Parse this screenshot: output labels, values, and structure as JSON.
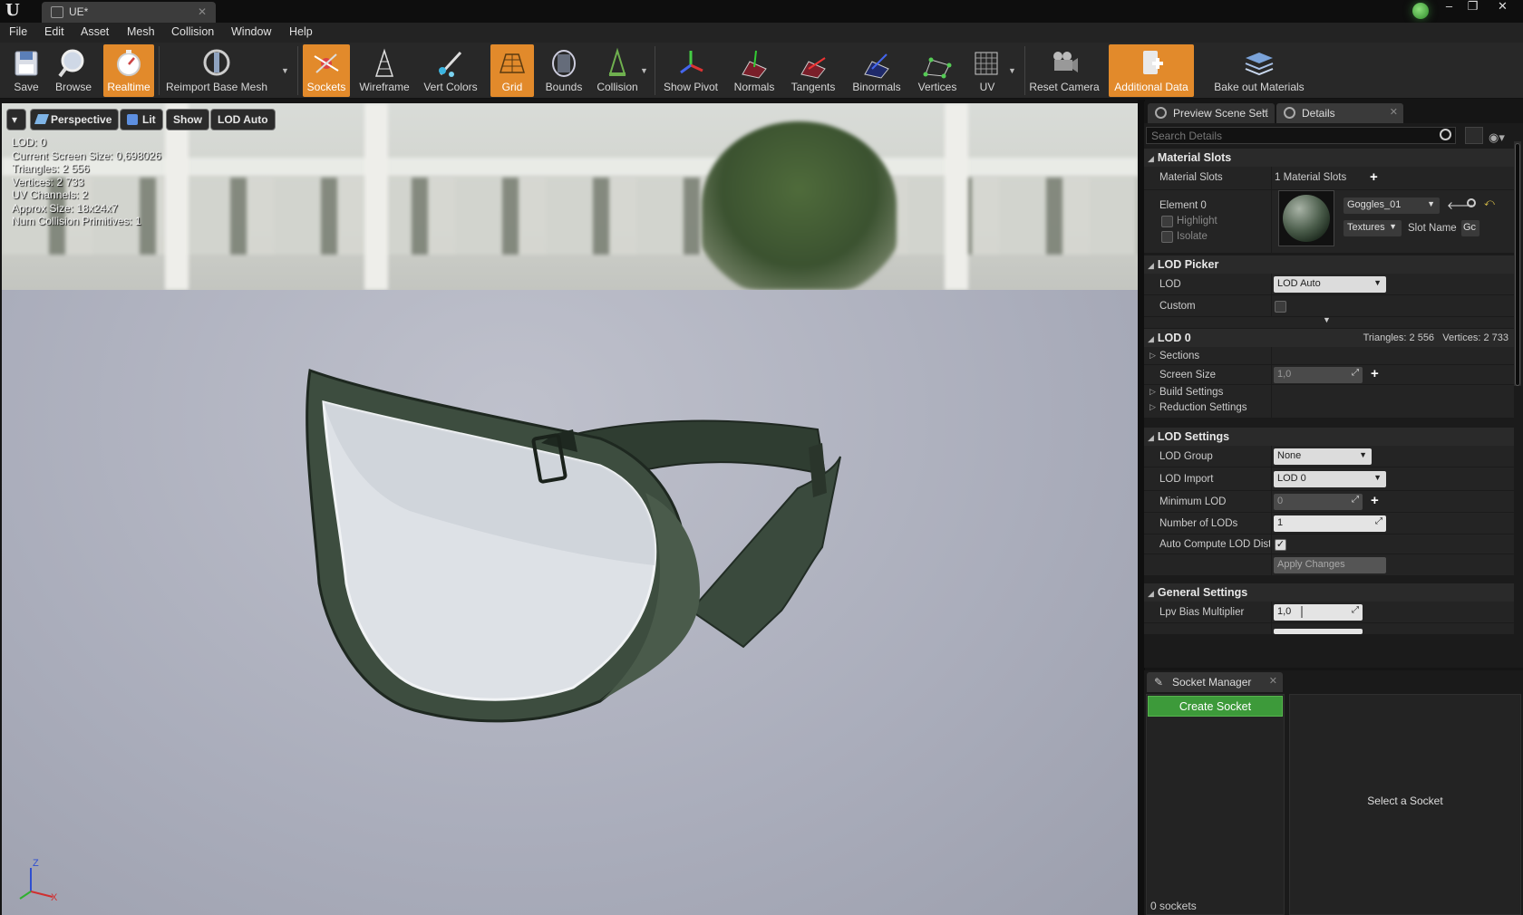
{
  "window": {
    "tab_title": "UE*",
    "controls": {
      "minimize": "‒",
      "restore": "❐",
      "close": "✕"
    }
  },
  "menu": [
    "File",
    "Edit",
    "Asset",
    "Mesh",
    "Collision",
    "Window",
    "Help"
  ],
  "toolbar": {
    "buttons": [
      {
        "label": "Save",
        "icon": "save-icon",
        "active": false
      },
      {
        "label": "Browse",
        "icon": "browse-icon",
        "active": false
      },
      {
        "label": "Realtime",
        "icon": "realtime-icon",
        "active": true
      },
      {
        "label": "Reimport Base Mesh",
        "icon": "reimport-icon",
        "active": false
      },
      {
        "label": "Sockets",
        "icon": "sockets-icon",
        "active": true
      },
      {
        "label": "Wireframe",
        "icon": "wireframe-icon",
        "active": false
      },
      {
        "label": "Vert Colors",
        "icon": "vert-colors-icon",
        "active": false
      },
      {
        "label": "Grid",
        "icon": "grid-icon",
        "active": true
      },
      {
        "label": "Bounds",
        "icon": "bounds-icon",
        "active": false
      },
      {
        "label": "Collision",
        "icon": "collision-icon",
        "active": false
      },
      {
        "label": "Show Pivot",
        "icon": "pivot-icon",
        "active": false
      },
      {
        "label": "Normals",
        "icon": "normals-icon",
        "active": false
      },
      {
        "label": "Tangents",
        "icon": "tangents-icon",
        "active": false
      },
      {
        "label": "Binormals",
        "icon": "binormals-icon",
        "active": false
      },
      {
        "label": "Vertices",
        "icon": "vertices-icon",
        "active": false
      },
      {
        "label": "UV",
        "icon": "uv-icon",
        "active": false
      },
      {
        "label": "Reset Camera",
        "icon": "camera-icon",
        "active": false
      },
      {
        "label": "Additional Data",
        "icon": "additional-data-icon",
        "active": true
      },
      {
        "label": "Bake out Materials",
        "icon": "bake-icon",
        "active": false
      }
    ]
  },
  "viewport": {
    "buttons": {
      "menu": "▾",
      "perspective": "Perspective",
      "lit": "Lit",
      "show": "Show",
      "lod": "LOD Auto"
    },
    "stats": [
      "LOD:  0",
      "Current Screen Size:  0,698026",
      "Triangles:  2 556",
      "Vertices:  2 733",
      "UV Channels:  2",
      "Approx Size: 18x24x7",
      "Num Collision Primitives:  1"
    ],
    "axis": {
      "z": "Z",
      "x": "X"
    }
  },
  "details": {
    "tabs": [
      "Preview Scene Sett",
      "Details"
    ],
    "search_placeholder": "Search Details",
    "material_slots": {
      "header": "Material Slots",
      "label": "Material Slots",
      "value": "1 Material Slots",
      "element": "Element 0",
      "highlight": "Highlight",
      "isolate": "Isolate",
      "material": "Goggles_01",
      "textures": "Textures",
      "slot_name_label": "Slot Name",
      "slot_name_value": "Gc"
    },
    "lod_picker": {
      "header": "LOD Picker",
      "lod_label": "LOD",
      "lod_value": "LOD Auto",
      "custom_label": "Custom"
    },
    "lod0": {
      "header": "LOD 0",
      "summary": "Triangles: 2 556   Vertices: 2 733",
      "sections": "Sections",
      "screen_size_label": "Screen Size",
      "screen_size_value": "1,0",
      "build_settings": "Build Settings",
      "reduction_settings": "Reduction Settings"
    },
    "lod_settings": {
      "header": "LOD Settings",
      "lod_group_label": "LOD Group",
      "lod_group_value": "None",
      "lod_import_label": "LOD Import",
      "lod_import_value": "LOD 0",
      "min_lod_label": "Minimum LOD",
      "min_lod_value": "0",
      "num_lods_label": "Number of LODs",
      "num_lods_value": "1",
      "auto_compute_label": "Auto Compute LOD Dista",
      "apply_changes": "Apply Changes"
    },
    "general_settings": {
      "header": "General Settings",
      "lpv_label": "Lpv Bias Multiplier",
      "lpv_value": "1,0"
    }
  },
  "socket_manager": {
    "tab": "Socket Manager",
    "create": "Create Socket",
    "empty": "Select a Socket",
    "count": "0 sockets"
  },
  "colors": {
    "accent": "#e28a2b",
    "create": "#3d9a3a"
  }
}
